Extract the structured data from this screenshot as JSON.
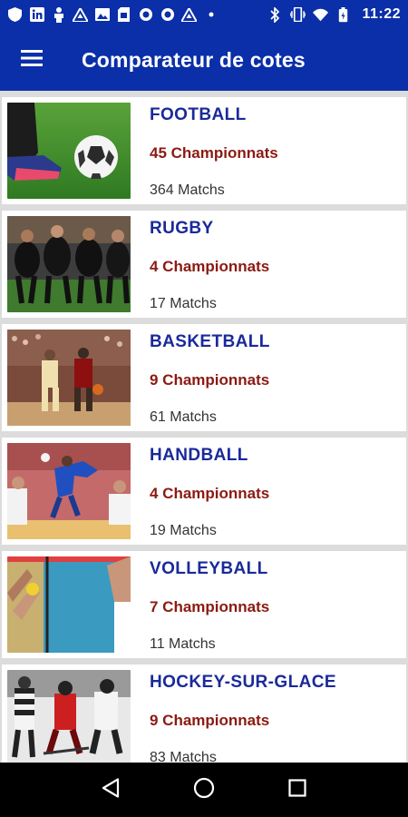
{
  "status_bar": {
    "time": "11:22",
    "left_icons": [
      "shield-icon",
      "linkedin-icon",
      "person-icon",
      "drive-icon",
      "image-icon",
      "sd-icon",
      "circle-icon",
      "circle-icon",
      "drive-icon",
      "dots-icon"
    ],
    "right_icons": [
      "bluetooth-icon",
      "vibrate-icon",
      "wifi-icon",
      "battery-icon"
    ]
  },
  "app_bar": {
    "title": "Comparateur de cotes",
    "menu_icon": "hamburger-icon"
  },
  "sports": [
    {
      "name": "FOOTBALL",
      "championships": "45 Championnats",
      "matches": "364 Matchs"
    },
    {
      "name": "RUGBY",
      "championships": "4 Championnats",
      "matches": "17 Matchs"
    },
    {
      "name": "BASKETBALL",
      "championships": "9 Championnats",
      "matches": "61 Matchs"
    },
    {
      "name": "HANDBALL",
      "championships": "4 Championnats",
      "matches": "19 Matchs"
    },
    {
      "name": "VOLLEYBALL",
      "championships": "7 Championnats",
      "matches": "11 Matchs"
    },
    {
      "name": "HOCKEY-SUR-GLACE",
      "championships": "9 Championnats",
      "matches": "83 Matchs"
    }
  ],
  "colors": {
    "primary": "#0a2fa8",
    "sport_name": "#1a2a9a",
    "championships": "#8b1a12"
  },
  "nav_bar": {
    "icons": [
      "back-icon",
      "home-icon",
      "recents-icon"
    ]
  }
}
